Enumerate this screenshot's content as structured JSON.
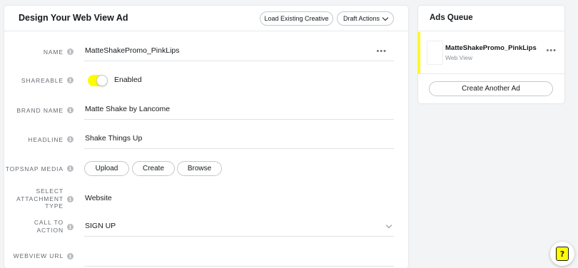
{
  "editor": {
    "title": "Design Your Web View Ad",
    "load_existing_label": "Load Existing Creative",
    "draft_actions_label": "Draft Actions",
    "more_icon": "ellipsis-icon",
    "info_glyph": "i",
    "fields": {
      "name": {
        "label": "NAME",
        "value": "MatteShakePromo_PinkLips"
      },
      "shareable": {
        "label": "SHAREABLE",
        "value": "Enabled",
        "on": true
      },
      "brand_name": {
        "label": "BRAND NAME",
        "value": "Matte Shake by Lancome"
      },
      "headline": {
        "label": "HEADLINE",
        "value": "Shake Things Up"
      },
      "topsnap_media": {
        "label": "TOPSNAP MEDIA",
        "buttons": [
          "Upload",
          "Create",
          "Browse"
        ]
      },
      "attachment_type": {
        "label_lines": [
          "SELECT",
          "ATTACHMENT",
          "TYPE"
        ],
        "value": "Website"
      },
      "call_to_action": {
        "label_lines": [
          "CALL TO",
          "ACTION"
        ],
        "value": "SIGN UP"
      },
      "webview_url": {
        "label": "WEBVIEW URL",
        "value": ""
      }
    }
  },
  "queue": {
    "title": "Ads Queue",
    "items": [
      {
        "name": "MatteShakePromo_PinkLips",
        "type": "Web View"
      }
    ],
    "create_another_label": "Create Another Ad"
  },
  "help": {
    "glyph": "?",
    "icon": "help-icon"
  },
  "colors": {
    "accent": "#fffc00",
    "text": "#16191c",
    "label": "#656b72",
    "border": "#dfe2e5"
  }
}
